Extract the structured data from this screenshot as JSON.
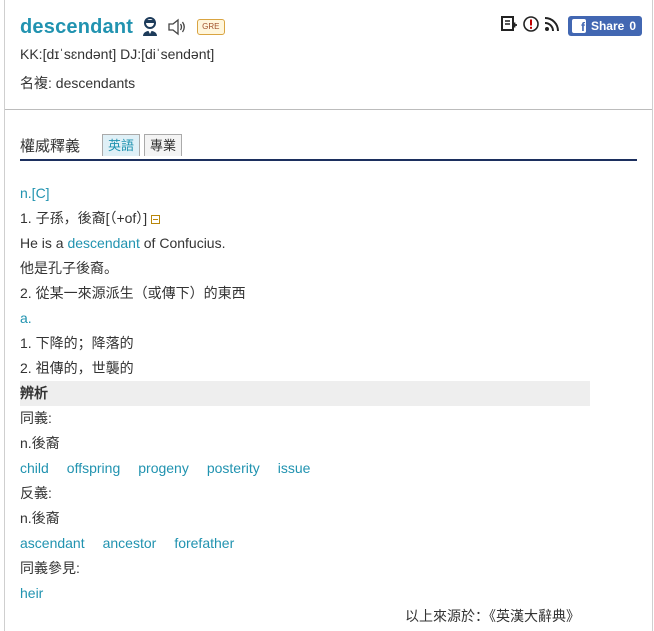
{
  "entry": {
    "headword": "descendant",
    "badge": "GRE",
    "pronunciation": "KK:[dɪˈsɛndənt] DJ:[diˈsendənt]",
    "forms": "名複: descendants"
  },
  "tools": {
    "share_label": "Share",
    "share_count": "0"
  },
  "tabs": {
    "title": "權威釋義",
    "items": [
      {
        "label": "英語",
        "active": true
      },
      {
        "label": "專業",
        "active": false
      }
    ]
  },
  "definitions": {
    "pos_n": "n.[C]",
    "def1": "1. 子孫，後裔[（+of）]",
    "ex1_pre": "He is a ",
    "ex1_word": "descendant",
    "ex1_post": " of Confucius.",
    "ex1_zh": "他是孔子後裔。",
    "def2": "2. 從某一來源派生（或傳下）的東西",
    "pos_a": "a.",
    "adj1": "1. 下降的；降落的",
    "adj2": "2. 祖傳的，世襲的"
  },
  "analysis": {
    "title": "辨析",
    "syn_label": "同義:",
    "syn_pos": "n.後裔",
    "synonyms": [
      "child",
      "offspring",
      "progeny",
      "posterity",
      "issue"
    ],
    "ant_label": "反義:",
    "ant_pos": "n.後裔",
    "antonyms": [
      "ascendant",
      "ancestor",
      "forefather"
    ],
    "see_also_label": "同義參見:",
    "see_also": [
      "heir"
    ]
  },
  "source": "以上來源於：《英漢大辭典》",
  "colors": {
    "accent": "#2193b0",
    "tab_underline": "#1c2f5e",
    "facebook": "#4267b2"
  }
}
